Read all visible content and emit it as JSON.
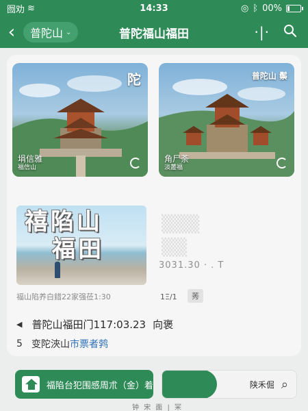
{
  "status_bar": {
    "carrier": "囫劝",
    "time": "14:33",
    "battery": "00%"
  },
  "header": {
    "back_icon": "chevron-left-icon",
    "location": "普陀山",
    "title": "普陀福山福田",
    "more_icon": "more-icon",
    "search_icon": "search-icon"
  },
  "cards": [
    {
      "corner": "陀",
      "caption_line1": "埍信雅",
      "caption_line2": "福信山"
    },
    {
      "corner": "普陀山 鬃",
      "caption_line1": "角尸荼",
      "caption_line2": "淡叢福"
    }
  ],
  "banner": {
    "line1": "禧陷山",
    "line2": "福田"
  },
  "faded_code": "3031.30 · . T",
  "info": {
    "desc": "福山陷养白錯22家强莅1:30",
    "page": "1Ξ/1",
    "tag": "莠"
  },
  "gate": {
    "name": "普陀山福田门117:03.23",
    "suffix": "向褒"
  },
  "ticket": {
    "number": "5",
    "prefix": "变陀浹山",
    "link": "市票者鹁"
  },
  "bottom": {
    "primary_label": "福陷台犯围感周朮（金）着汉",
    "secondary_label": "陕禾倔",
    "strip": "钟 宋 面 | 冞"
  },
  "colors": {
    "brand_green": "#2e8a57",
    "link_blue": "#2f6fb6"
  }
}
